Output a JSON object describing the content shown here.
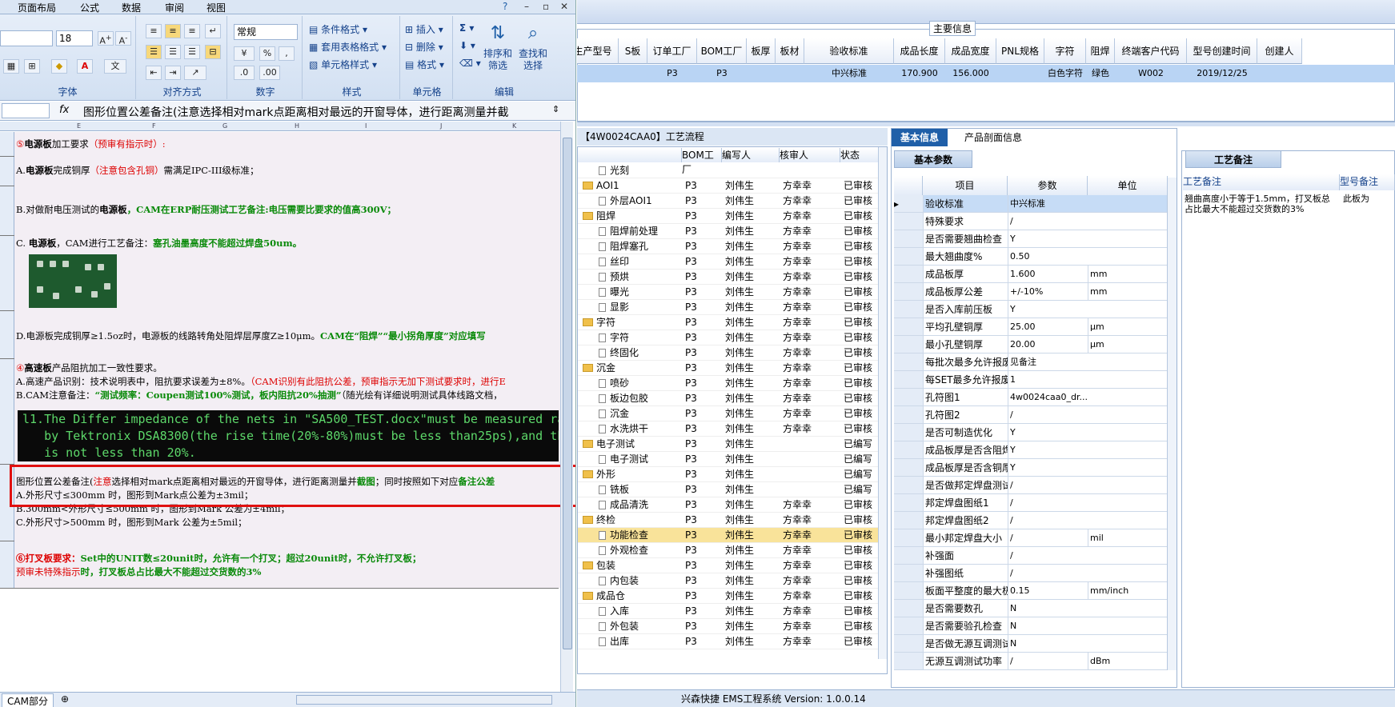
{
  "excel": {
    "menu": [
      "页面布局",
      "公式",
      "数据",
      "审阅",
      "视图"
    ],
    "font_size": "18",
    "number_format": "常规",
    "group_labels": [
      "字体",
      "对齐方式",
      "数字",
      "样式",
      "单元格",
      "编辑"
    ],
    "style_buttons": [
      "条件格式",
      "套用表格格式",
      "单元格样式"
    ],
    "cell_buttons": [
      "插入",
      "删除",
      "格式"
    ],
    "edit_buttons": [
      "排序和\n筛选",
      "查找和\n选择"
    ],
    "formula": "图形位置公差备注(注意选择相对mark点距离相对最远的开窗导体，进行距离测量并截",
    "col_letters": [
      "E",
      "F",
      "G",
      "H",
      "I",
      "J",
      "K",
      "L"
    ],
    "sheet_tab": "CAM部分",
    "rows": {
      "r1_a": "⑤",
      "r1_b": "电源板",
      "r1_c": "加工要求",
      "r1_d": "（预审有指示时）:",
      "r2_a": "A.",
      "r2_b": "电源板",
      "r2_c": "完成铜厚",
      "r2_d": "（注意包含孔铜）",
      "r2_e": "需满足IPC-III级标准；",
      "r3_a": "B.对做耐电压测试的",
      "r3_b": "电源板",
      "r3_c": "，CAM在ERP耐压测试工艺备注:电压需要比要求的值高300V；",
      "r4_a": "C. ",
      "r4_b": "电源板",
      "r4_c": "，CAM进行工艺备注：",
      "r4_d": "塞孔油墨高度不能超过焊盘50um。",
      "r5_a": "D.电源板完成铜厚≥1.5oz时，电源板的线路转角处阻焊层厚度Z≥10μm。",
      "r5_b": "CAM在“阻焊”“最小拐角厚度”对应填写",
      "r6_a": "④",
      "r6_b": "高速板",
      "r6_c": "产品阻抗加工一致性要求。",
      "r6_d": "A.高速产品识别：技术说明表中，阻抗要求误差为±8%。",
      "r6_e": "（CAM识别有此阻抗公差，预审指示无加下测试要求时，进行E",
      "r6_f": "B.CAM注意备注：",
      "r6_g": "“测试频率：Coupen测试100%测试，板内阻抗20%抽测”",
      "r6_h": "（随光绘有详细说明测试具体线路文档，",
      "code": "l1.The Differ impedance of the nets in \"SA500_TEST.docx\"must be measured ran\n   by Tektronix DSA8300(the rise time(20%-80%)must be less than25ps),and the\n   is not less than 20%.",
      "r7_a": "图形位置公差备注(",
      "r7_b": "注意",
      "r7_c": "选择相对mark点距离相对最远的开窗导体，进行距离测量并",
      "r7_d": "截图",
      "r7_e": "；同时按照如下对应",
      "r7_f": "备注公差",
      "r7_g": "A.外形尺寸≤300mm 时，图形到Mark点公差为±3mil；",
      "r7_h": "B.300mm<外形尺寸≤500mm 时，图形到Mark 公差为±4mil；",
      "r7_i": "C.外形尺寸>500mm 时，图形到Mark 公差为±5mil；",
      "r8_a": "⑥打叉板要求：",
      "r8_b": "Set中的UNIT数≤20unit时，允许有一个打叉；超过20unit时，不允许打叉板；",
      "r8_c": "预审未特殊指示",
      "r8_d": "时，打叉板总占比最大不能超过交货数的3%"
    }
  },
  "ems": {
    "main_legend": "主要信息",
    "grid_headers": [
      "生产型号",
      "S板",
      "订单工厂",
      "BOM工厂",
      "板厚",
      "板材",
      "验收标准",
      "成品长度",
      "成品宽度",
      "PNL规格",
      "字符",
      "阻焊",
      "终端客户代码",
      "型号创建时间",
      "创建人"
    ],
    "grid_row": [
      "",
      "",
      "P3",
      "P3",
      "",
      "",
      "中兴标准",
      "170.900",
      "156.000",
      "",
      "白色字符",
      "绿色",
      "W002",
      "2019/12/25",
      ""
    ],
    "flow_title": "【4W0024CAA0】工艺流程",
    "tree_headers": [
      "",
      "BOM工厂",
      "编写人",
      "核审人",
      "状态"
    ],
    "tree": [
      {
        "name": "光刻",
        "level": 2,
        "bom": "",
        "writer": "",
        "checker": "",
        "status": ""
      },
      {
        "name": "AOI1",
        "level": 1,
        "bom": "P3",
        "writer": "刘伟生",
        "checker": "方幸幸",
        "status": "已审核"
      },
      {
        "name": "外层AOI1",
        "level": 2,
        "bom": "P3",
        "writer": "刘伟生",
        "checker": "方幸幸",
        "status": "已审核"
      },
      {
        "name": "阻焊",
        "level": 1,
        "bom": "P3",
        "writer": "刘伟生",
        "checker": "方幸幸",
        "status": "已审核"
      },
      {
        "name": "阻焊前处理",
        "level": 2,
        "bom": "P3",
        "writer": "刘伟生",
        "checker": "方幸幸",
        "status": "已审核"
      },
      {
        "name": "阻焊塞孔",
        "level": 2,
        "bom": "P3",
        "writer": "刘伟生",
        "checker": "方幸幸",
        "status": "已审核"
      },
      {
        "name": "丝印",
        "level": 2,
        "bom": "P3",
        "writer": "刘伟生",
        "checker": "方幸幸",
        "status": "已审核"
      },
      {
        "name": "预烘",
        "level": 2,
        "bom": "P3",
        "writer": "刘伟生",
        "checker": "方幸幸",
        "status": "已审核"
      },
      {
        "name": "曝光",
        "level": 2,
        "bom": "P3",
        "writer": "刘伟生",
        "checker": "方幸幸",
        "status": "已审核"
      },
      {
        "name": "显影",
        "level": 2,
        "bom": "P3",
        "writer": "刘伟生",
        "checker": "方幸幸",
        "status": "已审核"
      },
      {
        "name": "字符",
        "level": 1,
        "bom": "P3",
        "writer": "刘伟生",
        "checker": "方幸幸",
        "status": "已审核"
      },
      {
        "name": "字符",
        "level": 2,
        "bom": "P3",
        "writer": "刘伟生",
        "checker": "方幸幸",
        "status": "已审核"
      },
      {
        "name": "终固化",
        "level": 2,
        "bom": "P3",
        "writer": "刘伟生",
        "checker": "方幸幸",
        "status": "已审核"
      },
      {
        "name": "沉金",
        "level": 1,
        "bom": "P3",
        "writer": "刘伟生",
        "checker": "方幸幸",
        "status": "已审核"
      },
      {
        "name": "喷砂",
        "level": 2,
        "bom": "P3",
        "writer": "刘伟生",
        "checker": "方幸幸",
        "status": "已审核"
      },
      {
        "name": "板边包胶",
        "level": 2,
        "bom": "P3",
        "writer": "刘伟生",
        "checker": "方幸幸",
        "status": "已审核"
      },
      {
        "name": "沉金",
        "level": 2,
        "bom": "P3",
        "writer": "刘伟生",
        "checker": "方幸幸",
        "status": "已审核"
      },
      {
        "name": "水洗烘干",
        "level": 2,
        "bom": "P3",
        "writer": "刘伟生",
        "checker": "方幸幸",
        "status": "已审核"
      },
      {
        "name": "电子测试",
        "level": 1,
        "bom": "P3",
        "writer": "刘伟生",
        "checker": "",
        "status": "已编写"
      },
      {
        "name": "电子测试",
        "level": 2,
        "bom": "P3",
        "writer": "刘伟生",
        "checker": "",
        "status": "已编写"
      },
      {
        "name": "外形",
        "level": 1,
        "bom": "P3",
        "writer": "刘伟生",
        "checker": "",
        "status": "已编写"
      },
      {
        "name": "铣板",
        "level": 2,
        "bom": "P3",
        "writer": "刘伟生",
        "checker": "",
        "status": "已编写"
      },
      {
        "name": "成品清洗",
        "level": 2,
        "bom": "P3",
        "writer": "刘伟生",
        "checker": "方幸幸",
        "status": "已审核"
      },
      {
        "name": "终检",
        "level": 1,
        "bom": "P3",
        "writer": "刘伟生",
        "checker": "方幸幸",
        "status": "已审核"
      },
      {
        "name": "功能检查",
        "level": 2,
        "bom": "P3",
        "writer": "刘伟生",
        "checker": "方幸幸",
        "status": "已审核",
        "selected": true
      },
      {
        "name": "外观检查",
        "level": 2,
        "bom": "P3",
        "writer": "刘伟生",
        "checker": "方幸幸",
        "status": "已审核"
      },
      {
        "name": "包装",
        "level": 1,
        "bom": "P3",
        "writer": "刘伟生",
        "checker": "方幸幸",
        "status": "已审核"
      },
      {
        "name": "内包装",
        "level": 2,
        "bom": "P3",
        "writer": "刘伟生",
        "checker": "方幸幸",
        "status": "已审核"
      },
      {
        "name": "成品仓",
        "level": 1,
        "bom": "P3",
        "writer": "刘伟生",
        "checker": "方幸幸",
        "status": "已审核"
      },
      {
        "name": "入库",
        "level": 2,
        "bom": "P3",
        "writer": "刘伟生",
        "checker": "方幸幸",
        "status": "已审核"
      },
      {
        "name": "外包装",
        "level": 2,
        "bom": "P3",
        "writer": "刘伟生",
        "checker": "方幸幸",
        "status": "已审核"
      },
      {
        "name": "出库",
        "level": 2,
        "bom": "P3",
        "writer": "刘伟生",
        "checker": "方幸幸",
        "status": "已审核"
      }
    ],
    "tabs": [
      "基本信息",
      "产品剖面信息"
    ],
    "subtab": "基本参数",
    "param_headers": [
      "项目",
      "参数",
      "单位"
    ],
    "params": [
      [
        "验收标准",
        "中兴标准",
        ""
      ],
      [
        "特殊要求",
        "/",
        ""
      ],
      [
        "是否需要翘曲检查",
        "Y",
        ""
      ],
      [
        "最大翘曲度%",
        "0.50",
        ""
      ],
      [
        "成品板厚",
        "1.600",
        "mm"
      ],
      [
        "成品板厚公差",
        "+/-10%",
        "mm"
      ],
      [
        "是否入库前压板",
        "Y",
        ""
      ],
      [
        "平均孔壁铜厚",
        "25.00",
        "μm"
      ],
      [
        "最小孔壁铜厚",
        "20.00",
        "μm"
      ],
      [
        "每批次最多允许报废SET",
        "见备注",
        ""
      ],
      [
        "每SET最多允许报废单元",
        "1",
        ""
      ],
      [
        "孔符图1",
        "4w0024caa0_dr...",
        ""
      ],
      [
        "孔符图2",
        "/",
        ""
      ],
      [
        "是否可制造优化",
        "Y",
        ""
      ],
      [
        "成品板厚是否含阻焊",
        "Y",
        ""
      ],
      [
        "成品板厚是否含铜厚",
        "Y",
        ""
      ],
      [
        "是否做邦定焊盘测试",
        "/",
        ""
      ],
      [
        "邦定焊盘图纸1",
        "/",
        ""
      ],
      [
        "邦定焊盘图纸2",
        "/",
        ""
      ],
      [
        "最小邦定焊盘大小",
        "/",
        "mil"
      ],
      [
        "补强面",
        "/",
        ""
      ],
      [
        "补强图纸",
        "/",
        ""
      ],
      [
        "板面平整度的最大极差",
        "0.15",
        "mm/inch"
      ],
      [
        "是否需要数孔",
        "N",
        ""
      ],
      [
        "是否需要验孔检查",
        "N",
        ""
      ],
      [
        "是否做无源互调测试",
        "N",
        ""
      ],
      [
        "无源互调测试功率",
        "/",
        "dBm"
      ]
    ],
    "remark_tab": "工艺备注",
    "remark_col1": "工艺备注",
    "remark_col2": "型号备注",
    "remark_text": "翘曲高度小于等于1.5mm，打叉板总占比最大不能超过交货数的3%",
    "remark_text2": "此板为",
    "status": "兴森快捷 EMS工程系统 Version: 1.0.0.14"
  }
}
